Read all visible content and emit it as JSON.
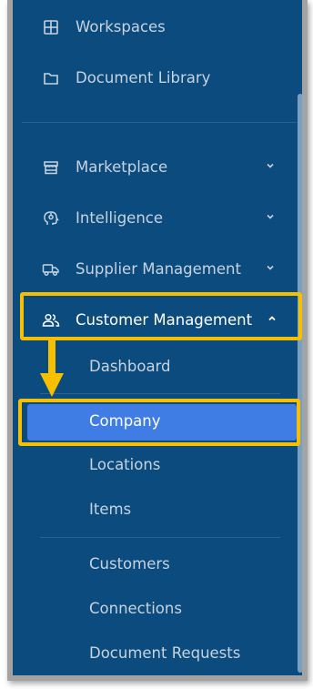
{
  "nav": {
    "workspaces": "Workspaces",
    "document_library": "Document Library",
    "marketplace": "Marketplace",
    "intelligence": "Intelligence",
    "supplier_management": "Supplier Management",
    "customer_management": "Customer Management"
  },
  "customer_management_items": {
    "dashboard": "Dashboard",
    "company": "Company",
    "locations": "Locations",
    "items": "Items",
    "customers": "Customers",
    "connections": "Connections",
    "document_requests": "Document Requests"
  },
  "colors": {
    "sidebar_bg": "#0c4b7d",
    "active_bg": "#3f7de4",
    "highlight": "#f6bf00"
  }
}
